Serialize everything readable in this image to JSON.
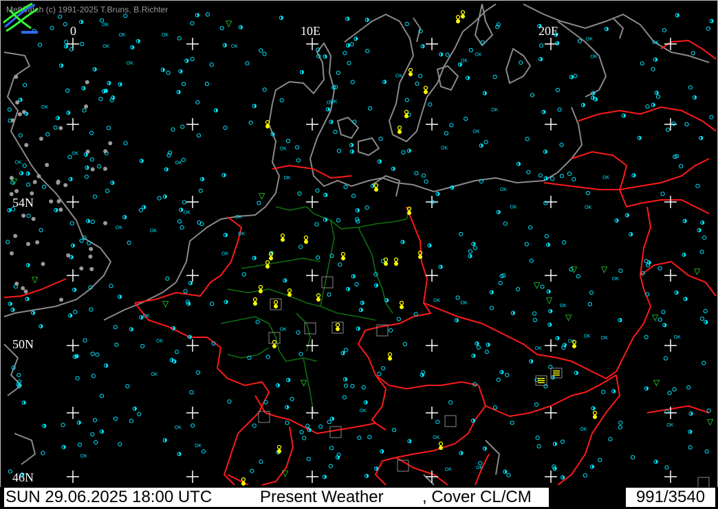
{
  "copyright": "MetWatch (c) 1991-2025 T.Bruns, B.Richter",
  "longitude_labels": [
    "0",
    "10E",
    "20E"
  ],
  "latitude_labels": [
    "54N",
    "50N",
    "46N"
  ],
  "status": {
    "datetime": "SUN 29.06.2025 18:00 UTC",
    "product": "Present Weather",
    "overlay": ", Cover CL/CM",
    "count": "991/3540"
  },
  "map_marker_text": "OK",
  "colors": {
    "background": "#000000",
    "coastline": "#8a8a8a",
    "border": "#ff1a1a",
    "state_border": "#0e6e0e",
    "grid": "#ffffff",
    "station": "#00e5ff",
    "weather_symbol": "#ffff00",
    "cloud_symbol": "#33ff33",
    "statusbar": "#ffffff"
  },
  "logo_icon": "metwatch-logo-icon"
}
